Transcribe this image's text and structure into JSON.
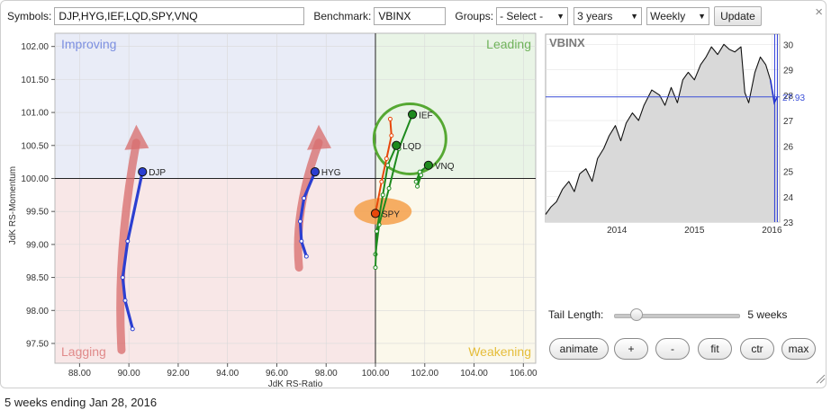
{
  "toolbar": {
    "symbols_label": "Symbols:",
    "symbols_value": "DJP,HYG,IEF,LQD,SPY,VNQ",
    "benchmark_label": "Benchmark:",
    "benchmark_value": "VBINX",
    "groups_label": "Groups:",
    "groups_selected": "- Select -",
    "period_selected": "3 years",
    "frequency_selected": "Weekly",
    "update_label": "Update",
    "close_glyph": "×"
  },
  "chart_data": [
    {
      "type": "scatter",
      "subtype": "relative-rotation-graph",
      "xlabel": "JdK RS-Ratio",
      "ylabel": "JdK RS-Momentum",
      "xlim": [
        87,
        106.5
      ],
      "ylim": [
        97.2,
        102.2
      ],
      "x_ticks": [
        "88.00",
        "90.00",
        "92.00",
        "94.00",
        "96.00",
        "98.00",
        "100.00",
        "102.00",
        "104.00",
        "106.00"
      ],
      "y_ticks": [
        "102.00",
        "101.50",
        "101.00",
        "100.50",
        "100.00",
        "99.50",
        "99.00",
        "98.50",
        "98.00",
        "97.50"
      ],
      "center": [
        100,
        100
      ],
      "grid": true,
      "quadrants": [
        {
          "name": "Improving",
          "label": "Improving",
          "color": "#e9ecf7",
          "label_color": "#7c8fe0",
          "position": "top-left"
        },
        {
          "name": "Leading",
          "label": "Leading",
          "color": "#e9f4e6",
          "label_color": "#6fb25a",
          "position": "top-right"
        },
        {
          "name": "Lagging",
          "label": "Lagging",
          "color": "#f8e7e7",
          "label_color": "#e08a8a",
          "position": "bottom-left"
        },
        {
          "name": "Weakening",
          "label": "Weakening",
          "color": "#fbf8eb",
          "label_color": "#e5bd3a",
          "position": "bottom-right"
        }
      ],
      "series": [
        {
          "name": "DJP",
          "color": "#2b3fd1",
          "points": [
            [
              90.15,
              97.72
            ],
            [
              89.85,
              98.15
            ],
            [
              89.75,
              98.5
            ],
            [
              89.95,
              99.05
            ],
            [
              90.55,
              100.1
            ]
          ]
        },
        {
          "name": "HYG",
          "color": "#2b3fd1",
          "points": [
            [
              97.2,
              98.82
            ],
            [
              97.0,
              99.05
            ],
            [
              96.95,
              99.35
            ],
            [
              97.1,
              99.7
            ],
            [
              97.55,
              100.1
            ]
          ]
        },
        {
          "name": "IEF",
          "color": "#1e8a1e",
          "points": [
            [
              100.0,
              98.85
            ],
            [
              100.15,
              99.3
            ],
            [
              100.55,
              99.85
            ],
            [
              100.95,
              100.45
            ],
            [
              101.5,
              100.97
            ]
          ]
        },
        {
          "name": "LQD",
          "color": "#1e8a1e",
          "points": [
            [
              100.0,
              98.65
            ],
            [
              100.05,
              99.2
            ],
            [
              100.3,
              99.75
            ],
            [
              100.5,
              100.2
            ],
            [
              100.85,
              100.5
            ]
          ]
        },
        {
          "name": "SPY",
          "color": "#e8470b",
          "points": [
            [
              100.6,
              100.9
            ],
            [
              100.65,
              100.65
            ],
            [
              100.45,
              100.3
            ],
            [
              100.25,
              99.95
            ],
            [
              100.0,
              99.47
            ]
          ]
        },
        {
          "name": "VNQ",
          "color": "#1e8a1e",
          "points": [
            [
              101.7,
              99.88
            ],
            [
              101.85,
              100.05
            ],
            [
              101.65,
              99.95
            ],
            [
              101.8,
              100.1
            ],
            [
              102.15,
              100.2
            ]
          ]
        }
      ],
      "highlights": [
        {
          "target": "LEADING-circle",
          "center": [
            101.4,
            100.6
          ],
          "color": "#55a832"
        },
        {
          "target": "SPY-oval",
          "center": [
            100.3,
            99.5
          ],
          "color": "#f5a04a"
        }
      ],
      "arrows": [
        {
          "from": [
            89.7,
            97.4
          ],
          "to": [
            90.3,
            100.65
          ],
          "color": "#d97070"
        },
        {
          "from": [
            96.9,
            98.65
          ],
          "to": [
            97.7,
            100.65
          ],
          "color": "#d97070"
        }
      ]
    },
    {
      "type": "area",
      "title": "VBINX",
      "xlim": [
        2013.08,
        2016.1
      ],
      "ylim": [
        23,
        30.4
      ],
      "x_ticks": [
        "2014",
        "2015",
        "2016"
      ],
      "y_ticks": [
        "23",
        "24",
        "25",
        "26",
        "27",
        "28",
        "29",
        "30"
      ],
      "current_value": "27.93",
      "grid": true,
      "values": [
        [
          2013.08,
          23.3
        ],
        [
          2013.15,
          23.6
        ],
        [
          2013.22,
          23.8
        ],
        [
          2013.3,
          24.3
        ],
        [
          2013.38,
          24.6
        ],
        [
          2013.45,
          24.2
        ],
        [
          2013.52,
          24.9
        ],
        [
          2013.6,
          25.1
        ],
        [
          2013.68,
          24.6
        ],
        [
          2013.75,
          25.5
        ],
        [
          2013.83,
          25.9
        ],
        [
          2013.9,
          26.4
        ],
        [
          2013.98,
          26.8
        ],
        [
          2014.05,
          26.2
        ],
        [
          2014.12,
          26.9
        ],
        [
          2014.2,
          27.3
        ],
        [
          2014.28,
          27.0
        ],
        [
          2014.35,
          27.6
        ],
        [
          2014.45,
          28.2
        ],
        [
          2014.55,
          28.0
        ],
        [
          2014.62,
          27.6
        ],
        [
          2014.7,
          28.3
        ],
        [
          2014.78,
          27.7
        ],
        [
          2014.85,
          28.6
        ],
        [
          2014.92,
          28.9
        ],
        [
          2015.0,
          28.6
        ],
        [
          2015.08,
          29.2
        ],
        [
          2015.15,
          29.5
        ],
        [
          2015.22,
          29.9
        ],
        [
          2015.3,
          29.6
        ],
        [
          2015.38,
          30.0
        ],
        [
          2015.45,
          29.8
        ],
        [
          2015.52,
          29.7
        ],
        [
          2015.6,
          29.9
        ],
        [
          2015.65,
          28.1
        ],
        [
          2015.7,
          27.7
        ],
        [
          2015.78,
          28.9
        ],
        [
          2015.85,
          29.5
        ],
        [
          2015.92,
          29.2
        ],
        [
          2015.98,
          28.6
        ],
        [
          2016.03,
          27.7
        ],
        [
          2016.07,
          27.93
        ]
      ]
    }
  ],
  "controls": {
    "tail_length_label": "Tail Length:",
    "tail_length_value": "5 weeks",
    "tail_fraction": 0.14,
    "buttons": [
      "animate",
      "+",
      "-",
      "fit",
      "ctr",
      "max"
    ]
  },
  "caption": "5 weeks ending Jan 28, 2016"
}
